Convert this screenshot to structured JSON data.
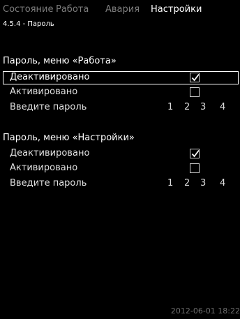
{
  "tabs": [
    {
      "label": "Состояние",
      "active": false
    },
    {
      "label": "Работа",
      "active": false
    },
    {
      "label": "Авария",
      "active": false
    },
    {
      "label": "Настройки",
      "active": true
    }
  ],
  "subtitle": "4.5.4 - Пароль",
  "sections": [
    {
      "title": "Пароль, меню «Работа»",
      "deactivated_label": "Деактивировано",
      "deactivated_checked": true,
      "activated_label": "Активировано",
      "activated_checked": false,
      "password_label": "Введите пароль",
      "password_digits": [
        "1",
        "2",
        "3",
        "4"
      ]
    },
    {
      "title": "Пароль, меню «Настройки»",
      "deactivated_label": "Деактивировано",
      "deactivated_checked": true,
      "activated_label": "Активировано",
      "activated_checked": false,
      "password_label": "Введите пароль",
      "password_digits": [
        "1",
        "2",
        "3",
        "4"
      ]
    }
  ],
  "timestamp": "2012-06-01 18:22",
  "colors": {
    "background": "#000000",
    "text": "#e6e6e6",
    "tab_inactive": "#7d7d7d",
    "timestamp": "#6e6e6e"
  },
  "icons": {
    "checkbox_checked": "checkmark-icon",
    "checkbox_empty": "empty-checkbox"
  }
}
